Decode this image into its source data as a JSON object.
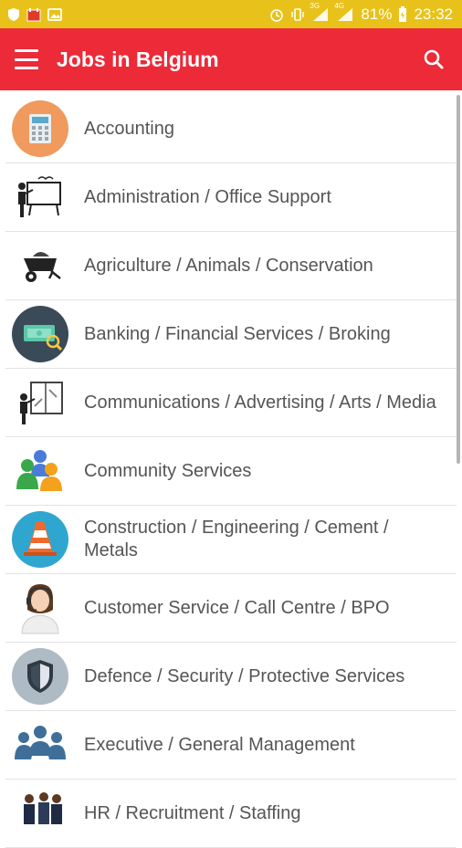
{
  "status_bar": {
    "network": "3G",
    "network2": "4G",
    "battery": "81%",
    "time": "23:32"
  },
  "app_bar": {
    "title": "Jobs in Belgium"
  },
  "colors": {
    "status_bar": "#e8c21a",
    "app_bar": "#ec2a38"
  },
  "categories": [
    {
      "label": "Accounting",
      "icon": "calculator-icon"
    },
    {
      "label": "Administration / Office Support",
      "icon": "presentation-icon"
    },
    {
      "label": "Agriculture / Animals / Conservation",
      "icon": "wheelbarrow-icon"
    },
    {
      "label": "Banking / Financial Services / Broking",
      "icon": "money-icon"
    },
    {
      "label": "Communications / Advertising / Arts / Media",
      "icon": "whiteboard-icon"
    },
    {
      "label": "Community Services",
      "icon": "people-icon"
    },
    {
      "label": "Construction / Engineering / Cement / Metals",
      "icon": "traffic-cone-icon"
    },
    {
      "label": "Customer Service / Call Centre / BPO",
      "icon": "headset-agent-icon"
    },
    {
      "label": "Defence / Security / Protective Services",
      "icon": "shield-icon"
    },
    {
      "label": "Executive / General Management",
      "icon": "team-icon"
    },
    {
      "label": "HR / Recruitment / Staffing",
      "icon": "staff-icon"
    }
  ]
}
